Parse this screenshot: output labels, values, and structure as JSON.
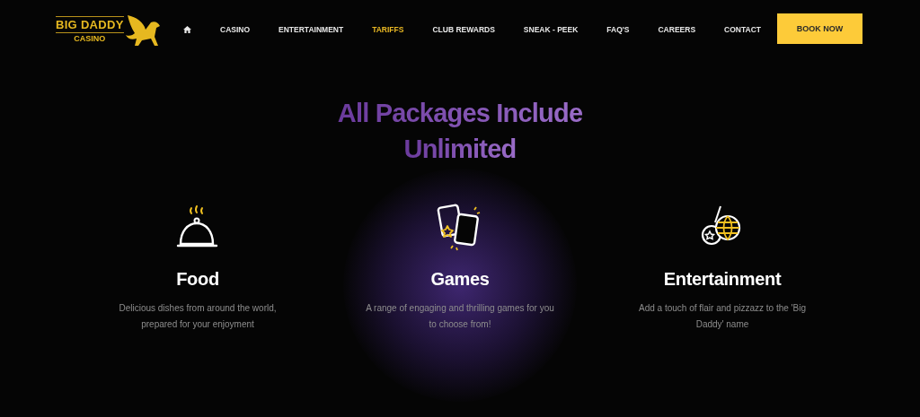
{
  "logo": {
    "title": "BIG DADDY",
    "subtitle": "CASINO"
  },
  "nav": [
    {
      "kind": "home",
      "selected": false
    },
    {
      "kind": "text",
      "label": "CASINO",
      "selected": false
    },
    {
      "kind": "text",
      "label": "ENTERTAINMENT",
      "selected": false
    },
    {
      "kind": "text",
      "label": "TARIFFS",
      "selected": true
    },
    {
      "kind": "text",
      "label": "CLUB REWARDS",
      "selected": false
    },
    {
      "kind": "text",
      "label": "SNEAK - PEEK",
      "selected": false
    },
    {
      "kind": "text",
      "label": "FAQ'S",
      "selected": false
    },
    {
      "kind": "text",
      "label": "CAREERS",
      "selected": false
    },
    {
      "kind": "text",
      "label": "CONTACT",
      "selected": false
    }
  ],
  "cta": "BOOK NOW",
  "heading": [
    "All Packages Include",
    "Unlimited"
  ],
  "features": [
    {
      "kind": "food",
      "title": "Food",
      "description": "Delicious dishes from around the world, prepared for your enjoyment",
      "highlighted": false
    },
    {
      "kind": "games",
      "title": "Games",
      "description": "A range of engaging and thrilling games for you to choose from!",
      "highlighted": true
    },
    {
      "kind": "entertainment",
      "title": "Entertainment",
      "description": "Add a touch of flair and pizzazz to the 'Big Daddy' name",
      "highlighted": false
    }
  ]
}
